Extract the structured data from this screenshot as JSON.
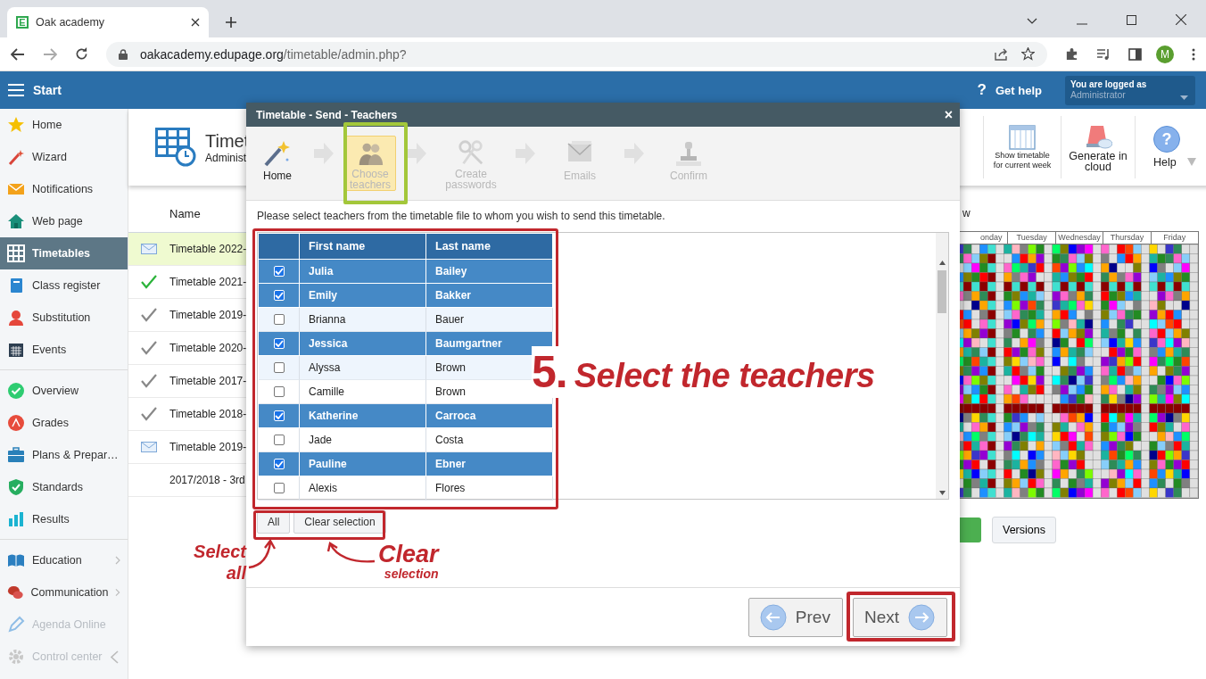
{
  "browser": {
    "tab_title": "Oak academy",
    "favicon": "E",
    "url_domain": "oakacademy.edupage.org",
    "url_path": "/timetable/admin.php?",
    "profile_initial": "M"
  },
  "app_bar": {
    "menu_label": "Start",
    "help_glyph": "?",
    "help_label": "Get help",
    "login_caption": "You are logged as",
    "login_user": "Administrator"
  },
  "sidebar": {
    "groups": [
      [
        {
          "label": "Home",
          "selected": false,
          "submenu": false,
          "disabled": false
        },
        {
          "label": "Wizard",
          "selected": false,
          "submenu": false,
          "disabled": false
        },
        {
          "label": "Notifications",
          "selected": false,
          "submenu": false,
          "disabled": false
        },
        {
          "label": "Web page",
          "selected": false,
          "submenu": false,
          "disabled": false
        },
        {
          "label": "Timetables",
          "selected": true,
          "submenu": false,
          "disabled": false
        },
        {
          "label": "Class register",
          "selected": false,
          "submenu": false,
          "disabled": false
        },
        {
          "label": "Substitution",
          "selected": false,
          "submenu": false,
          "disabled": false
        },
        {
          "label": "Events",
          "selected": false,
          "submenu": false,
          "disabled": false
        }
      ],
      [
        {
          "label": "Overview",
          "selected": false,
          "submenu": false,
          "disabled": false
        },
        {
          "label": "Grades",
          "selected": false,
          "submenu": false,
          "disabled": false
        },
        {
          "label": "Plans & Prepar…",
          "selected": false,
          "submenu": false,
          "disabled": false
        },
        {
          "label": "Standards",
          "selected": false,
          "submenu": false,
          "disabled": false
        },
        {
          "label": "Results",
          "selected": false,
          "submenu": false,
          "disabled": false
        }
      ],
      [
        {
          "label": "Education",
          "selected": false,
          "submenu": true,
          "disabled": false
        },
        {
          "label": "Communication",
          "selected": false,
          "submenu": true,
          "disabled": false
        },
        {
          "label": "Agenda Online",
          "selected": false,
          "submenu": false,
          "disabled": true
        },
        {
          "label": "Control center",
          "selected": false,
          "submenu": false,
          "disabled": true
        }
      ]
    ]
  },
  "page_header": {
    "title": "Timet",
    "subtitle": "Administ",
    "tools": [
      {
        "kind": "week",
        "label": "Show timetable for current week"
      },
      {
        "kind": "cloud",
        "label": "Generate in cloud"
      },
      {
        "kind": "help",
        "glyph": "?",
        "label": "Help"
      }
    ]
  },
  "timetables": {
    "column": "Name",
    "rows": [
      {
        "kind": "sent",
        "name": "Timetable 2022-",
        "selected": true
      },
      {
        "kind": "current",
        "name": "Timetable 2021-",
        "selected": false
      },
      {
        "kind": "past",
        "name": "Timetable 2019-",
        "selected": false
      },
      {
        "kind": "past",
        "name": "Timetable 2020-",
        "selected": false
      },
      {
        "kind": "past",
        "name": "Timetable 2017-",
        "selected": false
      },
      {
        "kind": "past",
        "name": "Timetable 2018-",
        "selected": false
      },
      {
        "kind": "sent",
        "name": "Timetable 2019-",
        "selected": false
      },
      {
        "kind": "plain",
        "name": "2017/2018 - 3rd",
        "selected": false
      }
    ]
  },
  "preview": {
    "heading": "w",
    "days": [
      "onday",
      "Tuesday",
      "Wednesday",
      "Thursday",
      "Friday"
    ],
    "versions_button": "Versions"
  },
  "dialog": {
    "title": "Timetable - Send - Teachers",
    "close": "×",
    "steps": [
      {
        "kind": "wand",
        "label": "Home",
        "selected": false,
        "disabled": false
      },
      {
        "kind": "people",
        "label": "Choose teachers",
        "selected": true,
        "disabled": true
      },
      {
        "kind": "keys",
        "label": "Create passwords",
        "selected": false,
        "disabled": true
      },
      {
        "kind": "emails",
        "label": "Emails",
        "selected": false,
        "disabled": true
      },
      {
        "kind": "stamp",
        "label": "Confirm",
        "selected": false,
        "disabled": true
      }
    ],
    "instruction": "Please select teachers from the timetable file to whom you wish to send this timetable.",
    "columns": [
      "First name",
      "Last name"
    ],
    "teachers": [
      {
        "first": "Julia",
        "last": "Bailey",
        "checked": true
      },
      {
        "first": "Emily",
        "last": "Bakker",
        "checked": true
      },
      {
        "first": "Brianna",
        "last": "Bauer",
        "checked": false
      },
      {
        "first": "Jessica",
        "last": "Baumgartner",
        "checked": true
      },
      {
        "first": "Alyssa",
        "last": "Brown",
        "checked": false
      },
      {
        "first": "Camille",
        "last": "Brown",
        "checked": false
      },
      {
        "first": "Katherine",
        "last": "Carroca",
        "checked": true
      },
      {
        "first": "Jade",
        "last": "Costa",
        "checked": false
      },
      {
        "first": "Pauline",
        "last": "Ebner",
        "checked": true
      },
      {
        "first": "Alexis",
        "last": "Flores",
        "checked": false
      }
    ],
    "all_button": "All",
    "clear_button": "Clear selection",
    "prev_button": "Prev",
    "next_button": "Next"
  },
  "annotations": {
    "step_number": "5.",
    "step_text": "Select the teachers",
    "select_all": "Select all",
    "clear_big": "Clear",
    "clear_small": "selection"
  }
}
